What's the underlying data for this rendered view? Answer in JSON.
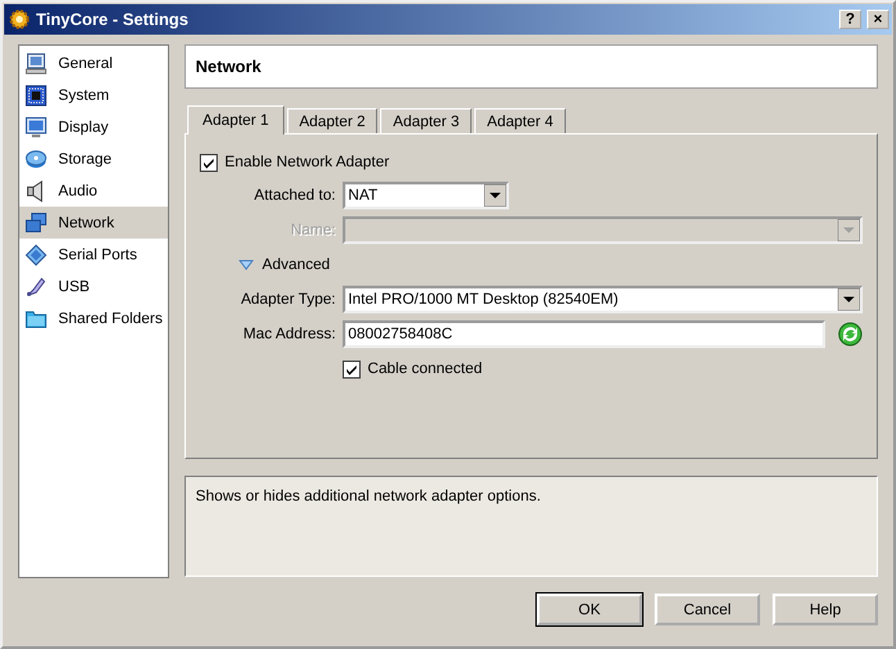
{
  "window": {
    "title": "TinyCore - Settings",
    "help_button": "?",
    "close_button": "×"
  },
  "sidebar": {
    "items": [
      {
        "label": "General",
        "selected": false
      },
      {
        "label": "System",
        "selected": false
      },
      {
        "label": "Display",
        "selected": false
      },
      {
        "label": "Storage",
        "selected": false
      },
      {
        "label": "Audio",
        "selected": false
      },
      {
        "label": "Network",
        "selected": true
      },
      {
        "label": "Serial Ports",
        "selected": false
      },
      {
        "label": "USB",
        "selected": false
      },
      {
        "label": "Shared Folders",
        "selected": false
      }
    ]
  },
  "header": "Network",
  "tabs": [
    {
      "label": "Adapter 1",
      "selected": true
    },
    {
      "label": "Adapter 2",
      "selected": false
    },
    {
      "label": "Adapter 3",
      "selected": false
    },
    {
      "label": "Adapter 4",
      "selected": false
    }
  ],
  "enable_adapter": {
    "label": "Enable Network Adapter",
    "checked": true
  },
  "attached_to": {
    "label": "Attached to:",
    "value": "NAT",
    "disabled": false
  },
  "name": {
    "label": "Name:",
    "disabled": true
  },
  "advanced": {
    "label": "Advanced",
    "expanded": true
  },
  "adapter_type": {
    "label": "Adapter Type:",
    "value": "Intel PRO/1000 MT Desktop (82540EM)",
    "disabled": false
  },
  "mac_address": {
    "label": "Mac Address:",
    "value": "08002758408C"
  },
  "cable_connected": {
    "label": "Cable connected",
    "checked": true
  },
  "description": "Shows or hides additional network adapter options.",
  "buttons": [
    {
      "label": "OK",
      "default": true
    },
    {
      "label": "Cancel",
      "default": false
    },
    {
      "label": "Help",
      "default": false
    }
  ]
}
